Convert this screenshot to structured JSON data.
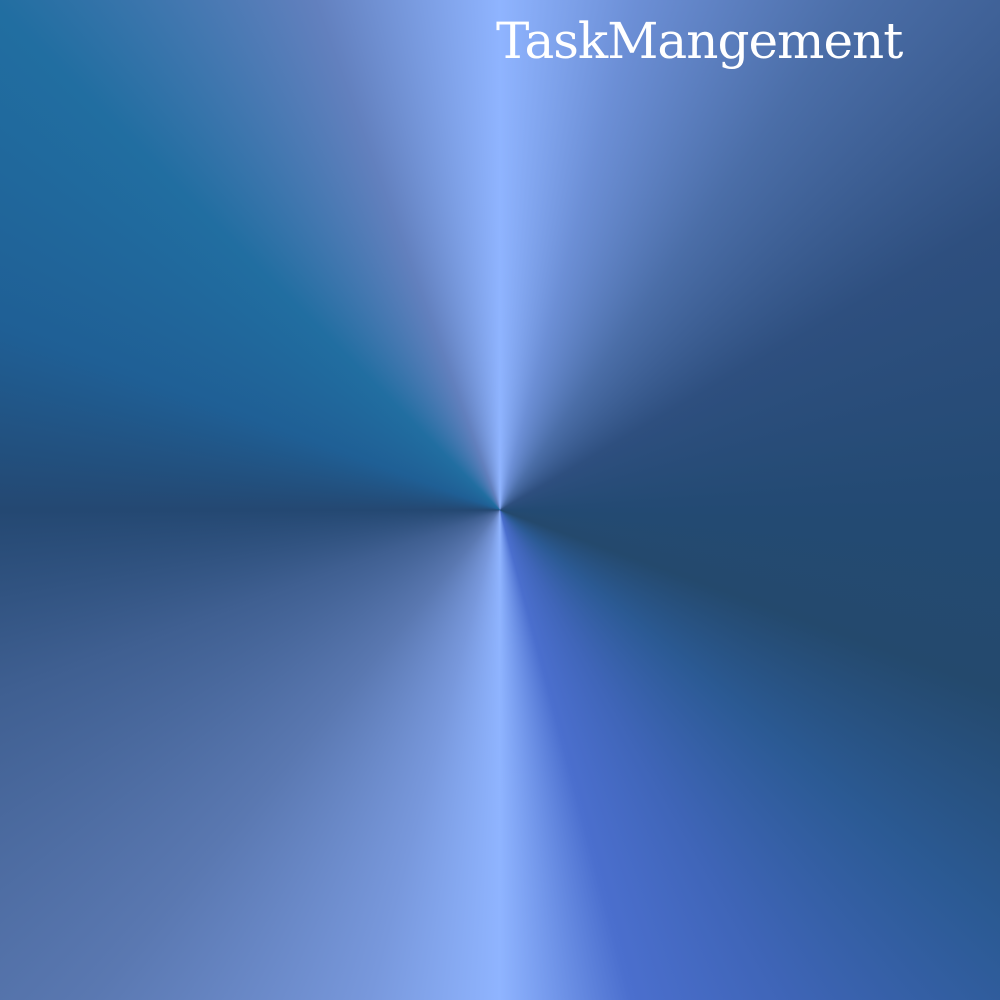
{
  "app": {
    "title": "TaskMangement"
  },
  "colors": {
    "highlight": "#8fb4ff",
    "midnight_blue": "#234a73",
    "accent_blue": "#4b6fce",
    "title_text": "#ffffff"
  }
}
